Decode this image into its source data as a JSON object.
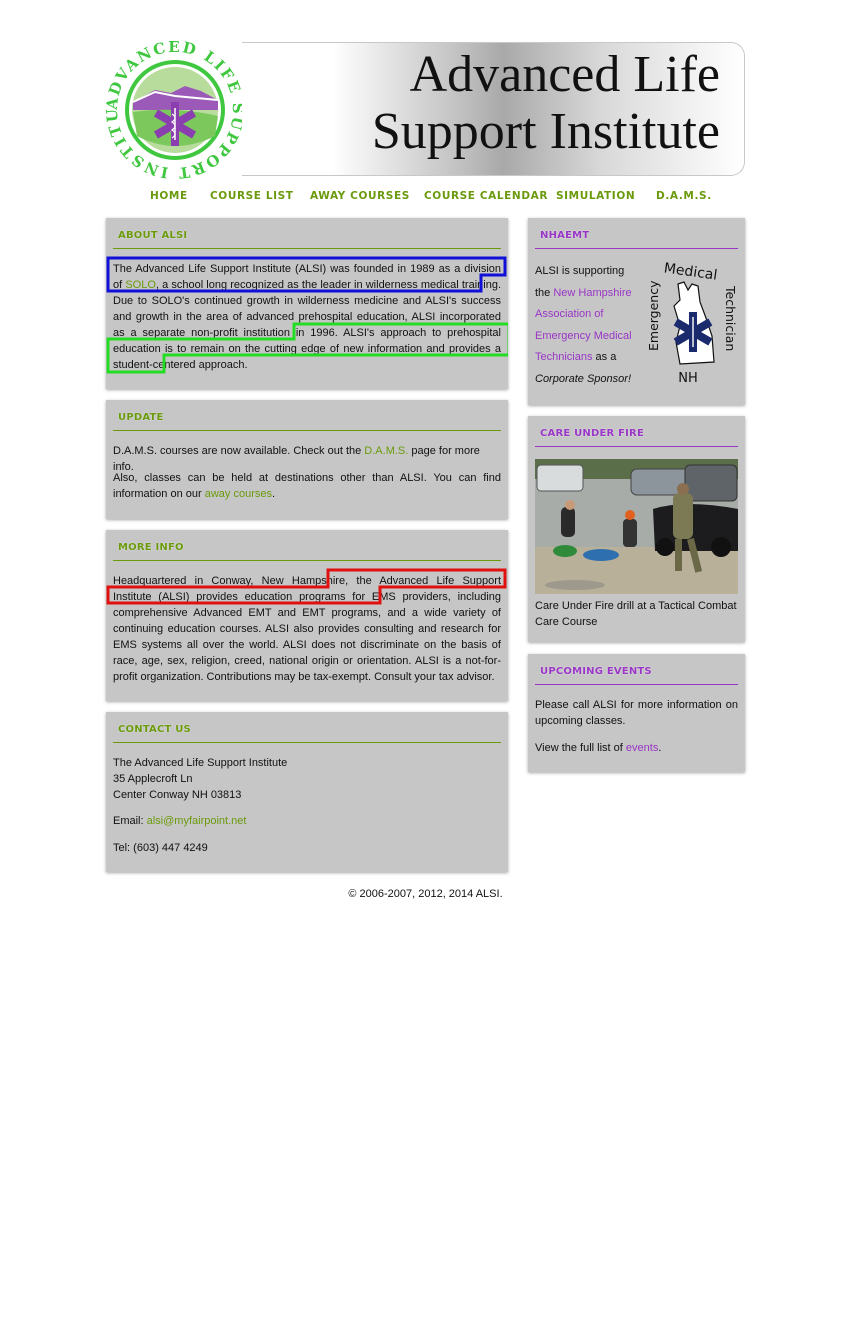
{
  "header": {
    "logo_ring_text": "ADVANCED LIFE SUPPORT INSTITUTE",
    "title_line1": "Advanced Life",
    "title_line2": "Support Institute"
  },
  "nav": {
    "items": [
      "HOME",
      "COURSE LIST",
      "AWAY COURSES",
      "COURSE CALENDAR",
      "SIMULATION",
      "D.A.M.S."
    ]
  },
  "about": {
    "title": "ABOUT ALSI",
    "p1_a": "The Advanced Life Support Institute (ALSI) was founded in 1989 as a division of",
    "p1_link": "SOLO",
    "p1_b": ", a school long recognized as the leader in wilderness medical training. Due to SOLO's continued growth in wilderness medicine and ALSI's success and growth in the area of advanced prehospital education, ALSI incorporated as a separate non-profit institution in 1996. ALSI's approach to prehospital education is to remain on the cutting edge of new information and provides a student-centered approach."
  },
  "update": {
    "title": "UPDATE",
    "p1_a": "D.A.M.S. courses are now available. Check out the ",
    "p1_link": "D.A.M.S.",
    "p1_b": " page for more info.",
    "p2_a": "Also, classes can be held at destinations other than ALSI. You can find information on our ",
    "p2_link": "away courses",
    "p2_b": "."
  },
  "more_info": {
    "title": "MORE INFO",
    "p1": "Headquartered in Conway, New Hampshire, the Advanced Life Support Institute (ALSI) provides education programs for EMS providers, including comprehensive Advanced EMT and EMT programs, and a wide variety of continuing education courses. ALSI also provides consulting and research for EMS systems all over the world. ALSI does not discriminate on the basis of race, age, sex, religion, creed, national origin or orientation. ALSI is a not-for-profit organization. Contributions may be tax-exempt. Consult your tax advisor."
  },
  "contact": {
    "title": "CONTACT US",
    "line1": "The Advanced Life Support Institute",
    "line2": "35 Applecroft Ln",
    "line3": "Center Conway NH 03813",
    "email_label": "Email: ",
    "email": "alsi@myfairpoint.net",
    "tel": "Tel: (603) 447 4249"
  },
  "nhaemt": {
    "title": "NHAEMT",
    "t1": "ALSI is supporting the ",
    "link": "New Hampshire Association of Emergency Medical Technicians",
    "t2": " as a ",
    "t3": "Corporate Sponsor!",
    "logo_top": "Medical",
    "logo_left": "Emergency",
    "logo_right": "Technician",
    "logo_bottom": "NH"
  },
  "care_under_fire": {
    "title": "CARE UNDER FIRE",
    "caption": "Care Under Fire drill at a Tactical Combat Care Course"
  },
  "events": {
    "title": "UPCOMING EVENTS",
    "p1": "Please call ALSI for more information on upcoming classes.",
    "p2_a": "View the full list of ",
    "p2_link": "events",
    "p2_b": "."
  },
  "footer": {
    "text": "© 2006-2007, 2012, 2014 ALSI."
  },
  "colors": {
    "green": "#6a9a0c",
    "purple": "#9936c6",
    "panel_bg": "#c6c6c6",
    "highlight_blue": "#1010d8",
    "highlight_green": "#22dd22",
    "highlight_red": "#e01010"
  }
}
